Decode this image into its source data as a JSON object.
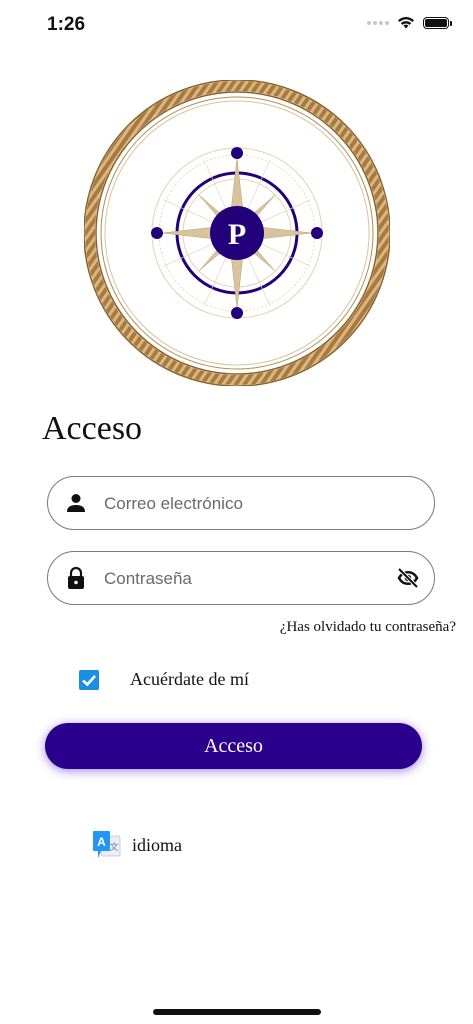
{
  "status_bar": {
    "time": "1:26"
  },
  "page": {
    "title": "Acceso"
  },
  "logo": {
    "letter": "P"
  },
  "email_field": {
    "placeholder": "Correo electrónico",
    "value": ""
  },
  "password_field": {
    "placeholder": "Contraseña",
    "value": ""
  },
  "forgot_password": "¿Has olvidado tu contraseña?",
  "remember_me": {
    "label": "Acuérdate de mí",
    "checked": true
  },
  "login_button": {
    "label": "Acceso"
  },
  "language": {
    "label": "idioma"
  },
  "colors": {
    "primary": "#2a008c",
    "checkbox": "#1a8fe3",
    "gold": "#a87a3e"
  }
}
